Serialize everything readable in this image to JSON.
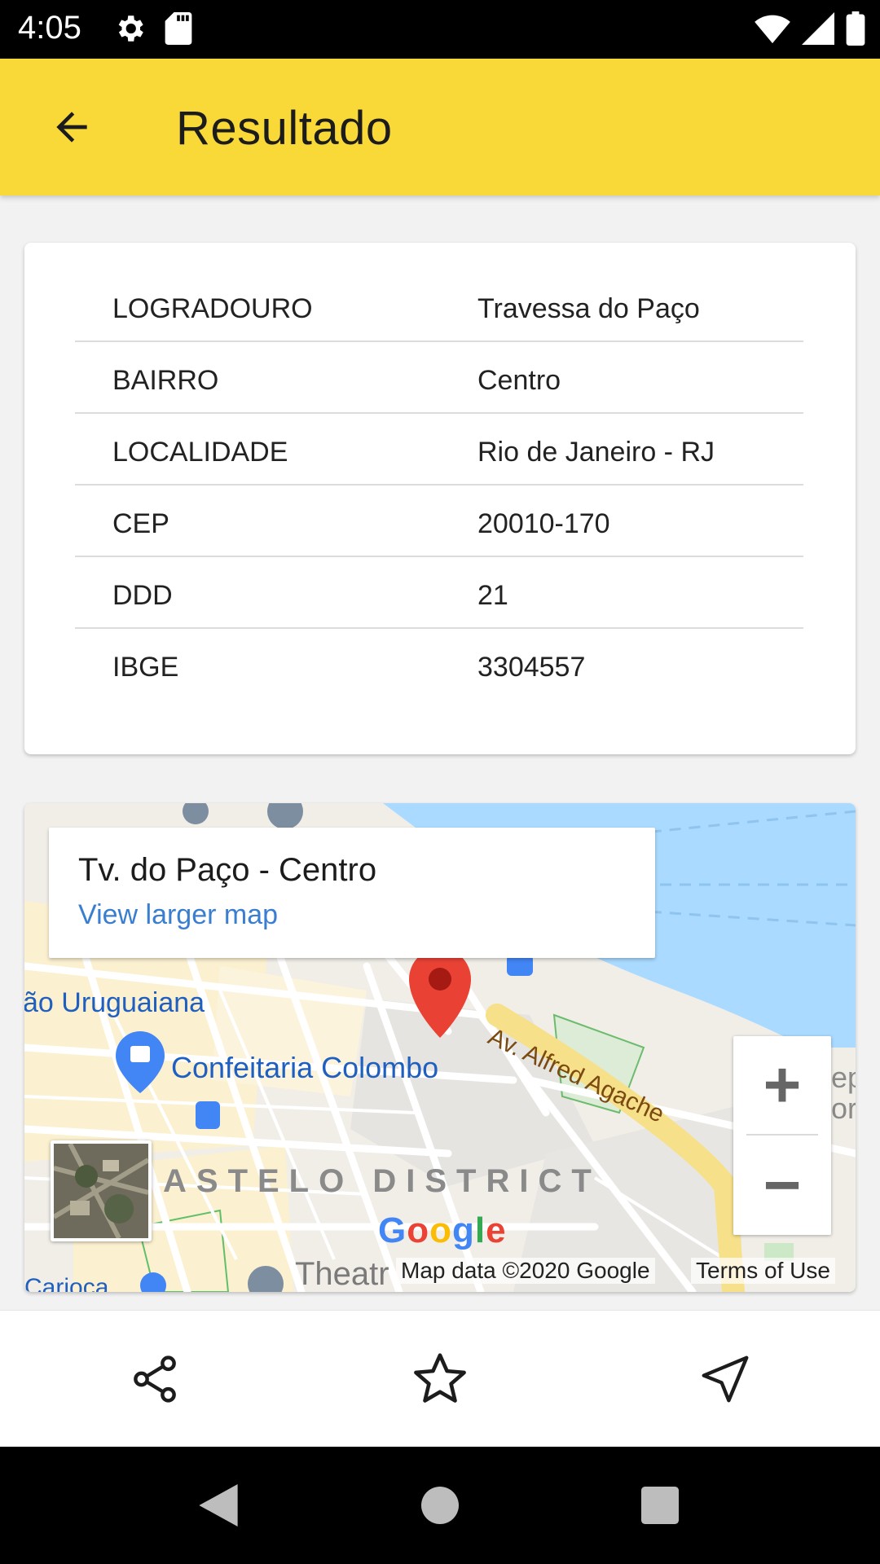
{
  "status_bar": {
    "time": "4:05",
    "left_icons": [
      "settings-icon",
      "sd-card-icon"
    ],
    "right_icons": [
      "wifi-icon",
      "signal-icon",
      "battery-icon"
    ]
  },
  "app_bar": {
    "title": "Resultado",
    "back_icon": "arrow-back-icon",
    "background_color": "#f9d938"
  },
  "info_table": {
    "rows": [
      {
        "key": "LOGRADOURO",
        "value": "Travessa do Paço"
      },
      {
        "key": "BAIRRO",
        "value": "Centro"
      },
      {
        "key": "LOCALIDADE",
        "value": "Rio de Janeiro - RJ"
      },
      {
        "key": "CEP",
        "value": "20010-170"
      },
      {
        "key": "DDD",
        "value": "21"
      },
      {
        "key": "IBGE",
        "value": "3304557"
      }
    ]
  },
  "map": {
    "popup_title": "Tv. do Paço - Centro",
    "popup_link": "View larger map",
    "labels": {
      "station": "ão Uruguaiana",
      "poi": "Confeitaria Colombo",
      "district": "ASTELO DISTRICT",
      "street": "Av. Alfred Agache",
      "bottom_left": "Carioca",
      "theatre": "Theatr",
      "right_edge": "ep\nor"
    },
    "google_logo": "Google",
    "attribution": "Map data ©2020 Google",
    "terms": "Terms of Use",
    "zoom_in": "+",
    "zoom_out": "−",
    "marker_color": "#e94235",
    "water_color": "#aadaff"
  },
  "actions": {
    "share_icon": "share-icon",
    "favorite_icon": "star-icon",
    "navigate_icon": "navigation-icon"
  },
  "nav_bar": {
    "icons": [
      "back-triangle-icon",
      "home-circle-icon",
      "recents-square-icon"
    ]
  }
}
